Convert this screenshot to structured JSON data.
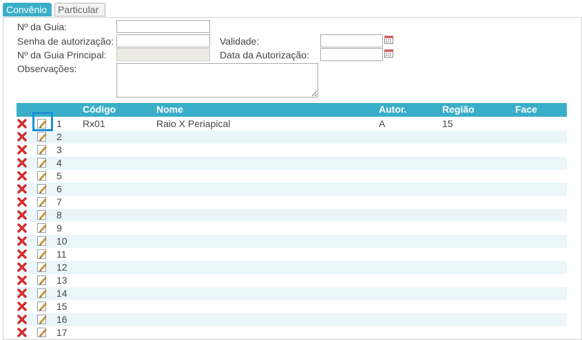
{
  "tabs": [
    {
      "label": "Convênio",
      "active": true
    },
    {
      "label": "Particular",
      "active": false
    }
  ],
  "form": {
    "guia_label": "Nº da Guia:",
    "guia_value": "",
    "senha_label": "Senha de autorização:",
    "senha_value": "",
    "validade_label": "Validade:",
    "validade_value": "",
    "guia_principal_label": "Nº da Guia Principal:",
    "guia_principal_value": "",
    "data_autorizacao_label": "Data da Autorização:",
    "data_autorizacao_value": "",
    "observacoes_label": "Observações:",
    "observacoes_value": ""
  },
  "grid": {
    "columns": {
      "codigo": "Código",
      "nome": "Nome",
      "autor": "Autor.",
      "regiao": "Região",
      "face": "Face"
    },
    "rows": [
      {
        "num": "1",
        "codigo": "Rx01",
        "nome": "Raio X Periapical",
        "autor": "A",
        "regiao": "15",
        "face": ""
      },
      {
        "num": "2",
        "codigo": "",
        "nome": "",
        "autor": "",
        "regiao": "",
        "face": ""
      },
      {
        "num": "3",
        "codigo": "",
        "nome": "",
        "autor": "",
        "regiao": "",
        "face": ""
      },
      {
        "num": "4",
        "codigo": "",
        "nome": "",
        "autor": "",
        "regiao": "",
        "face": ""
      },
      {
        "num": "5",
        "codigo": "",
        "nome": "",
        "autor": "",
        "regiao": "",
        "face": ""
      },
      {
        "num": "6",
        "codigo": "",
        "nome": "",
        "autor": "",
        "regiao": "",
        "face": ""
      },
      {
        "num": "7",
        "codigo": "",
        "nome": "",
        "autor": "",
        "regiao": "",
        "face": ""
      },
      {
        "num": "8",
        "codigo": "",
        "nome": "",
        "autor": "",
        "regiao": "",
        "face": ""
      },
      {
        "num": "9",
        "codigo": "",
        "nome": "",
        "autor": "",
        "regiao": "",
        "face": ""
      },
      {
        "num": "10",
        "codigo": "",
        "nome": "",
        "autor": "",
        "regiao": "",
        "face": ""
      },
      {
        "num": "11",
        "codigo": "",
        "nome": "",
        "autor": "",
        "regiao": "",
        "face": ""
      },
      {
        "num": "12",
        "codigo": "",
        "nome": "",
        "autor": "",
        "regiao": "",
        "face": ""
      },
      {
        "num": "13",
        "codigo": "",
        "nome": "",
        "autor": "",
        "regiao": "",
        "face": ""
      },
      {
        "num": "14",
        "codigo": "",
        "nome": "",
        "autor": "",
        "regiao": "",
        "face": ""
      },
      {
        "num": "15",
        "codigo": "",
        "nome": "",
        "autor": "",
        "regiao": "",
        "face": ""
      },
      {
        "num": "16",
        "codigo": "",
        "nome": "",
        "autor": "",
        "regiao": "",
        "face": ""
      },
      {
        "num": "17",
        "codigo": "",
        "nome": "",
        "autor": "",
        "regiao": "",
        "face": ""
      }
    ]
  },
  "icons": {
    "delete": "delete-x-icon",
    "edit": "edit-pencil-icon",
    "calendar": "calendar-icon"
  },
  "colors": {
    "accent": "#3aaec8",
    "row_alt": "#eaf6fa",
    "delete_red": "#cc1f1f",
    "focus": "#1a8fd6"
  }
}
